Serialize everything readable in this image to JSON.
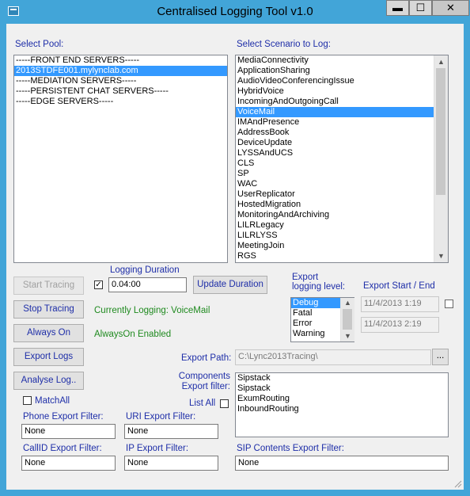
{
  "window": {
    "title": "Centralised Logging Tool v1.0",
    "minimize_glyph": "▬",
    "maximize_glyph": "☐",
    "close_glyph": "✕"
  },
  "pool": {
    "label": "Select Pool:",
    "items": [
      "-----FRONT END SERVERS-----",
      "2013STDFE001.mylynclab.com",
      "-----MEDIATION SERVERS-----",
      "-----PERSISTENT CHAT SERVERS-----",
      "-----EDGE SERVERS-----"
    ],
    "selected": "2013STDFE001.mylynclab.com"
  },
  "scenario": {
    "label": "Select Scenario to Log:",
    "items": [
      "MediaConnectivity",
      "ApplicationSharing",
      "AudioVideoConferencingIssue",
      "HybridVoice",
      "IncomingAndOutgoingCall",
      "VoiceMail",
      "IMAndPresence",
      "AddressBook",
      "DeviceUpdate",
      "LYSSAndUCS",
      "CLS",
      "SP",
      "WAC",
      "UserReplicator",
      "HostedMigration",
      "MonitoringAndArchiving",
      "LILRLegacy",
      "LILRLYSS",
      "MeetingJoin",
      "RGS"
    ],
    "selected": "VoiceMail"
  },
  "tracing": {
    "start_label": "Start Tracing",
    "stop_label": "Stop Tracing",
    "always_on_label": "Always On",
    "logging_duration_label": "Logging Duration",
    "duration_value": "0.04:00",
    "duration_checked_glyph": "✓",
    "update_duration_label": "Update Duration",
    "currently_logging": "Currently Logging: VoiceMail",
    "always_on_status": "AlwaysOn Enabled"
  },
  "export": {
    "level_label": "Export logging level:",
    "levels": [
      "Debug",
      "Fatal",
      "Error",
      "Warning"
    ],
    "selected_level": "Debug",
    "start_end_label": "Export Start / End",
    "start_value": "11/4/2013 1:19",
    "end_value": "11/4/2013 2:19",
    "export_logs_label": "Export Logs",
    "analyse_label": "Analyse Log..",
    "path_label": "Export Path:",
    "path_value": "C:\\Lync2013Tracing\\",
    "browse_label": "...",
    "components_label": "Components Export filter:",
    "list_all_label": "List All",
    "components": [
      "Sipstack",
      "Sipstack",
      "ExumRouting",
      "InboundRouting"
    ],
    "match_all_label": "MatchAll"
  },
  "filters": {
    "phone_label": "Phone Export Filter:",
    "phone_value": "None",
    "uri_label": "URI Export Filter:",
    "uri_value": "None",
    "callid_label": "CallID Export Filter:",
    "callid_value": "None",
    "ip_label": "IP Export Filter:",
    "ip_value": "None",
    "sip_label": "SIP Contents Export Filter:",
    "sip_value": "None"
  }
}
